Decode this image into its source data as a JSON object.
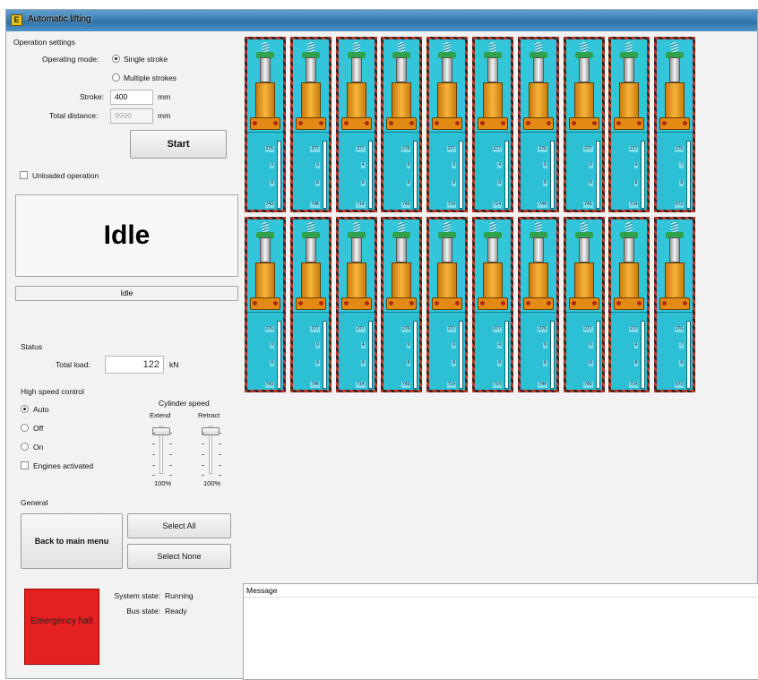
{
  "window": {
    "title": "Automatic lifting"
  },
  "operation_settings": {
    "group_label": "Operation settings",
    "mode_label": "Operating mode:",
    "modes": [
      {
        "label": "Single stroke",
        "checked": true
      },
      {
        "label": "Multiple strokes",
        "checked": false
      }
    ],
    "stroke_label": "Stroke:",
    "stroke_value": "400",
    "stroke_unit": "mm",
    "total_distance_label": "Total distance:",
    "total_distance_value": "9999",
    "total_distance_unit": "mm",
    "start_button": "Start",
    "unloaded_label": "Unloaded operation"
  },
  "state": {
    "big": "Idle",
    "small": "Idle"
  },
  "status": {
    "group_label": "Status",
    "total_load_label": "Total load:",
    "total_load_value": "122",
    "total_load_unit": "kN"
  },
  "high_speed": {
    "group_label": "High speed control",
    "options": [
      {
        "label": "Auto",
        "checked": true
      },
      {
        "label": "Off",
        "checked": false
      },
      {
        "label": "On",
        "checked": false
      }
    ],
    "engines_label": "Engines activated"
  },
  "cylinder_speed": {
    "label": "Cylinder speed",
    "extend_label": "Extend",
    "retract_label": "Retract",
    "extend_value": "100%",
    "retract_value": "100%"
  },
  "general": {
    "group_label": "General",
    "back_button": "Back to main menu",
    "select_all_button": "Select All",
    "select_none_button": "Select None"
  },
  "emergency": {
    "label": "Emergency halt"
  },
  "system": {
    "system_state_label": "System state:",
    "system_state_value": "Running",
    "bus_state_label": "Bus state:",
    "bus_state_value": "Ready"
  },
  "message": {
    "header": "Message"
  },
  "cylinders": {
    "row1": [
      {
        "v1": "276",
        "v2": "9",
        "v3": "8",
        "v4": "743"
      },
      {
        "v1": "277",
        "v2": "9",
        "v3": "8",
        "v4": "744"
      },
      {
        "v1": "277",
        "v2": "4",
        "v3": "8",
        "v4": "714"
      },
      {
        "v1": "276",
        "v2": "9",
        "v3": "8",
        "v4": "743"
      },
      {
        "v1": "277",
        "v2": "9",
        "v3": "8",
        "v4": "714"
      },
      {
        "v1": "277",
        "v2": "4",
        "v3": "8",
        "v4": "714"
      },
      {
        "v1": "276",
        "v2": "9",
        "v3": "8",
        "v4": "744"
      },
      {
        "v1": "277",
        "v2": "9",
        "v3": "8",
        "v4": "743"
      },
      {
        "v1": "277",
        "v2": "4",
        "v3": "8",
        "v4": "714"
      },
      {
        "v1": "276",
        "v2": "7",
        "v3": "8",
        "v4": "673"
      }
    ],
    "row2": [
      {
        "v1": "276",
        "v2": "9",
        "v3": "8",
        "v4": "743"
      },
      {
        "v1": "277",
        "v2": "9",
        "v3": "8",
        "v4": "744"
      },
      {
        "v1": "277",
        "v2": "4",
        "v3": "8",
        "v4": "714"
      },
      {
        "v1": "276",
        "v2": "9",
        "v3": "8",
        "v4": "743"
      },
      {
        "v1": "277",
        "v2": "9",
        "v3": "8",
        "v4": "714"
      },
      {
        "v1": "277",
        "v2": "4",
        "v3": "8",
        "v4": "714"
      },
      {
        "v1": "276",
        "v2": "9",
        "v3": "8",
        "v4": "744"
      },
      {
        "v1": "277",
        "v2": "9",
        "v3": "8",
        "v4": "743"
      },
      {
        "v1": "277",
        "v2": "4",
        "v3": "8",
        "v4": "714"
      },
      {
        "v1": "276",
        "v2": "7",
        "v3": "8",
        "v4": "673"
      }
    ]
  }
}
